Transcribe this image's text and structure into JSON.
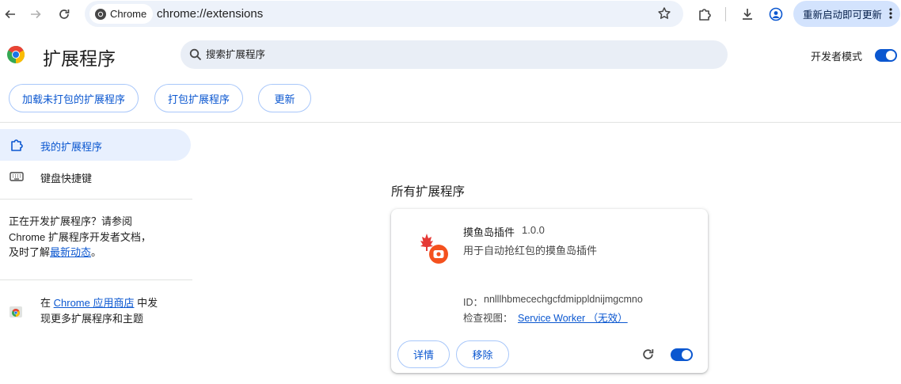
{
  "browser": {
    "chip_label": "Chrome",
    "url": "chrome://extensions",
    "update_button_label": "重新启动即可更新"
  },
  "header": {
    "title": "扩展程序",
    "search_placeholder": "搜索扩展程序",
    "dev_mode_label": "开发者模式",
    "dev_mode_on": true
  },
  "actions": {
    "load_unpacked": "加载未打包的扩展程序",
    "pack": "打包扩展程序",
    "update": "更新"
  },
  "sidebar": {
    "items": [
      {
        "label": "我的扩展程序",
        "active": true,
        "icon": "puzzle-icon"
      },
      {
        "label": "键盘快捷键",
        "active": false,
        "icon": "keyboard-icon"
      }
    ],
    "dev_promo": {
      "line1": "正在开发扩展程序？请参阅",
      "line2": "Chrome 扩展程序开发者文档，",
      "line3_prefix": "及时了解",
      "line3_link": "最新动态",
      "line3_suffix": "。"
    },
    "store_promo": {
      "prefix": "在 ",
      "link": "Chrome 应用商店",
      "suffix": " 中发",
      "line2": "现更多扩展程序和主题"
    }
  },
  "main": {
    "section_title": "所有扩展程序",
    "extension": {
      "name": "摸鱼岛插件",
      "version": "1.0.0",
      "description": "用于自动抢红包的摸鱼岛插件",
      "id_label": "ID：",
      "id": "nnlllhbmecechgcfdmippldnijmgcmno",
      "views_label": "检查视图：",
      "views_link": "Service Worker （无效）",
      "details_label": "详情",
      "remove_label": "移除",
      "enabled": true
    }
  },
  "colors": {
    "accent": "#0b57d0",
    "omnibox_bg": "#edf2fa",
    "active_nav_bg": "#e8f0fe"
  }
}
